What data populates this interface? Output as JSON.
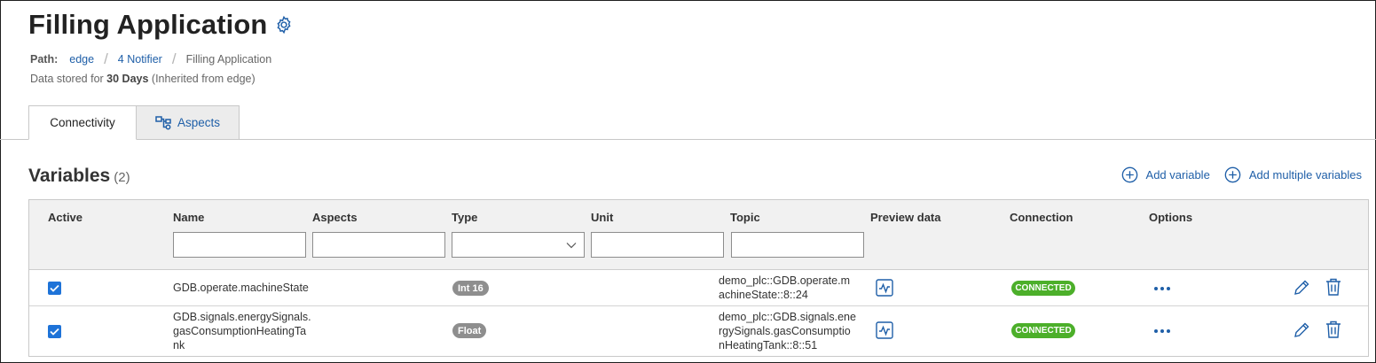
{
  "header": {
    "title": "Filling Application",
    "path_label": "Path:",
    "breadcrumb": [
      "edge",
      "4 Notifier",
      "Filling Application"
    ],
    "retention_prefix": "Data stored for",
    "retention_value": "30 Days",
    "retention_suffix": "(Inherited from edge)"
  },
  "tabs": [
    {
      "label": "Connectivity",
      "active": true
    },
    {
      "label": "Aspects",
      "active": false
    }
  ],
  "variables": {
    "title": "Variables",
    "count": "(2)",
    "add_variable": "Add variable",
    "add_multiple": "Add multiple variables",
    "columns": [
      "Active",
      "Name",
      "Aspects",
      "Type",
      "Unit",
      "Topic",
      "Preview data",
      "Connection",
      "Options"
    ],
    "filters": {
      "name": "",
      "aspects": "",
      "type": "",
      "unit": "",
      "topic": ""
    },
    "rows": [
      {
        "active": true,
        "name_lines": [
          "GDB.operate.machineState"
        ],
        "type": "Int 16",
        "topic_lines": [
          "demo_plc::GDB.operate.m",
          "achineState::8::24"
        ],
        "connection": "CONNECTED"
      },
      {
        "active": true,
        "name_lines": [
          "GDB.signals.energySignals.",
          "gasConsumptionHeatingTa",
          "nk"
        ],
        "type": "Float",
        "topic_lines": [
          "demo_plc::GDB.signals.ene",
          "rgySignals.gasConsumptio",
          "nHeatingTank::8::51"
        ],
        "connection": "CONNECTED"
      }
    ]
  },
  "colors": {
    "accent": "#1f5fa8",
    "checkbox": "#1e73d8",
    "connected": "#4caf2a",
    "type_badge": "#8e8e8e"
  },
  "icons": [
    "gear-icon",
    "aspects-icon",
    "add-circle-icon",
    "chevron-down-icon",
    "preview-chart-icon",
    "more-options-icon",
    "pencil-icon",
    "trash-icon",
    "checkmark-icon"
  ]
}
